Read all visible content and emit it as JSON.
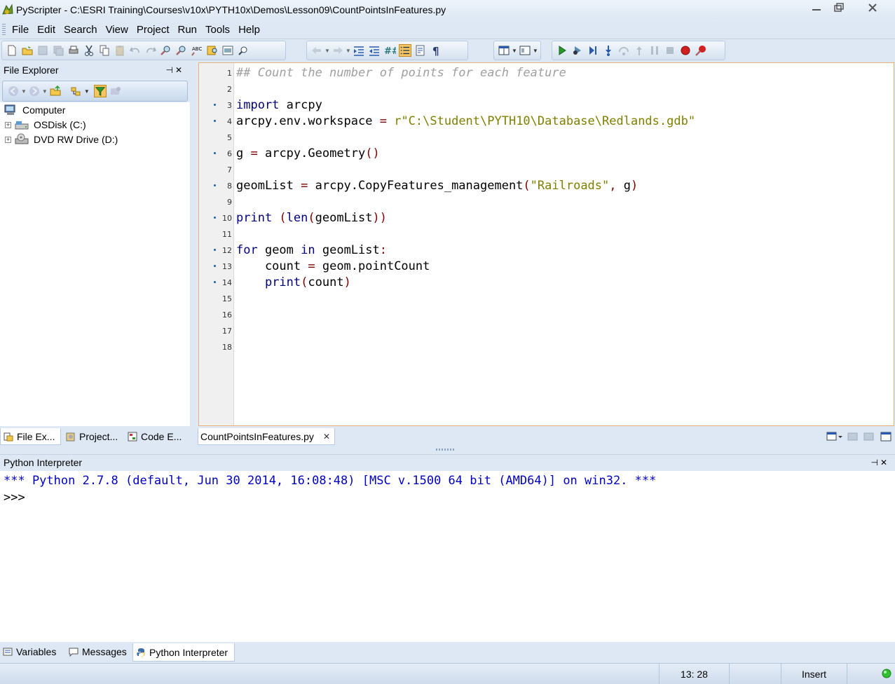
{
  "window": {
    "title": "PyScripter - C:\\ESRI Training\\Courses\\v10x\\PYTH10x\\Demos\\Lesson09\\CountPointsInFeatures.py",
    "minimize_icon": "minimize-icon",
    "maximize_icon": "restore-icon",
    "close_icon": "close-icon"
  },
  "menu": [
    "File",
    "Edit",
    "Search",
    "View",
    "Project",
    "Run",
    "Tools",
    "Help"
  ],
  "file_explorer": {
    "title": "File Explorer",
    "tree": [
      {
        "label": "Computer",
        "icon": "computer-icon"
      },
      {
        "label": "OSDisk (C:)",
        "icon": "drive-icon"
      },
      {
        "label": "DVD RW Drive (D:)",
        "icon": "dvd-drive-icon"
      }
    ],
    "tabs": [
      "File Ex...",
      "Project...",
      "Code E..."
    ]
  },
  "editor": {
    "file_tab": "CountPointsInFeatures.py",
    "line_numbers": [
      "1",
      "2",
      "3",
      "4",
      "5",
      "6",
      "7",
      "8",
      "9",
      "10",
      "11",
      "12",
      "13",
      "14",
      "15",
      "16",
      "17",
      "18"
    ],
    "lines": {
      "l1": "## Count the number of points for each feature",
      "l3_kw": "import",
      "l3_rest": " arcpy",
      "l4_a": "arcpy.env.workspace ",
      "l4_op": "=",
      "l4_b": " ",
      "l4_str": "r\"C:\\Student\\PYTH10\\Database\\Redlands.gdb\"",
      "l6_a": "g ",
      "l6_op": "=",
      "l6_b": " arcpy.Geometry",
      "l6_p": "()",
      "l8_a": "geomList ",
      "l8_op": "=",
      "l8_b": " arcpy.CopyFeatures_management",
      "l8_p1": "(",
      "l8_str": "\"Railroads\"",
      "l8_c": ",",
      "l8_d": " g",
      "l8_p2": ")",
      "l10_kw": "print",
      "l10_p1": " (",
      "l10_kw2": "len",
      "l10_p2": "(",
      "l10_a": "geomList",
      "l10_p3": "))",
      "l12_kw": "for",
      "l12_a": " geom ",
      "l12_kw2": "in",
      "l12_b": " geomList",
      "l12_c": ":",
      "l13_a": "    count ",
      "l13_op": "=",
      "l13_b": " geom.pointCount",
      "l14_indent": "    ",
      "l14_kw": "print",
      "l14_p1": "(",
      "l14_a": "count",
      "l14_p2": ")"
    }
  },
  "interpreter": {
    "title": "Python Interpreter",
    "banner": "*** Python 2.7.8 (default, Jun 30 2014, 16:08:48) [MSC v.1500 64 bit (AMD64)] on win32. ***",
    "prompt": ">>>",
    "tabs": [
      "Variables",
      "Messages",
      "Python Interpreter"
    ]
  },
  "status": {
    "position": "13: 28",
    "mode": "Insert"
  },
  "colors": {
    "keyword": "#00007f",
    "comment": "#a0a0a0",
    "string": "#7f7f00",
    "operator": "#7f0000",
    "interp_banner": "#0000c0"
  }
}
